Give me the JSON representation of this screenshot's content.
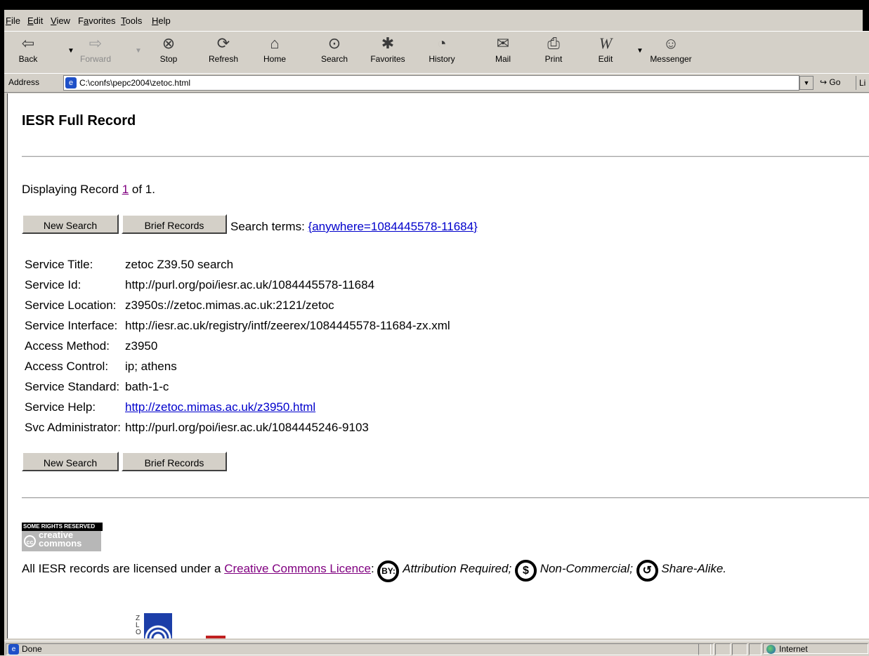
{
  "menu": {
    "items": [
      "File",
      "Edit",
      "View",
      "Favorites",
      "Tools",
      "Help"
    ],
    "underline": [
      "F",
      "E",
      "V",
      "a",
      "T",
      "H"
    ]
  },
  "toolbar": {
    "back": "Back",
    "forward": "Forward",
    "stop": "Stop",
    "refresh": "Refresh",
    "home": "Home",
    "search": "Search",
    "favorites": "Favorites",
    "history": "History",
    "mail": "Mail",
    "print": "Print",
    "edit": "Edit",
    "messenger": "Messenger"
  },
  "address": {
    "label": "Address",
    "value": "C:\\confs\\pepc2004\\zetoc.html",
    "go": "Go",
    "links": "Li"
  },
  "page": {
    "title": "IESR Full Record",
    "displaying_prefix": "Displaying Record ",
    "record_num": "1",
    "displaying_suffix": " of 1.",
    "new_search": "New Search",
    "brief_records": "Brief Records",
    "search_terms_label": "Search terms: ",
    "search_terms_link": "{anywhere=1084445578-11684}",
    "record": [
      {
        "label": "Service Title:",
        "value": "zetoc Z39.50 search",
        "link": false
      },
      {
        "label": "Service Id:",
        "value": "http://purl.org/poi/iesr.ac.uk/1084445578-11684",
        "link": false
      },
      {
        "label": "Service Location:",
        "value": "z3950s://zetoc.mimas.ac.uk:2121/zetoc",
        "link": false
      },
      {
        "label": "Service Interface:",
        "value": "http://iesr.ac.uk/registry/intf/zeerex/1084445578-11684-zx.xml",
        "link": false
      },
      {
        "label": "Access Method:",
        "value": "z3950",
        "link": false
      },
      {
        "label": "Access Control:",
        "value": "ip; athens",
        "link": false
      },
      {
        "label": "Service Standard:",
        "value": "bath-1-c",
        "link": false
      },
      {
        "label": "Service Help:",
        "value": "http://zetoc.mimas.ac.uk/z3950.html",
        "link": true
      },
      {
        "label": "Svc Administrator:",
        "value": "http://purl.org/poi/iesr.ac.uk/1084445246-9103",
        "link": false
      }
    ],
    "cc_badge_top": "SOME RIGHTS RESERVED",
    "cc_badge_bottom": "creative commons",
    "license_prefix": "All IESR records are licensed under a ",
    "license_link": "Creative Commons Licence",
    "license_colon": ":",
    "attribution": "Attribution Required",
    "noncommercial": "Non-Commercial",
    "sharealike": "Share-Alike",
    "by_icon_text": "BY:",
    "nc_icon_text": "$",
    "sa_icon_text": "↺",
    "sil_text": "Z\nL\nO"
  },
  "status": {
    "done": "Done",
    "zone": "Internet"
  }
}
